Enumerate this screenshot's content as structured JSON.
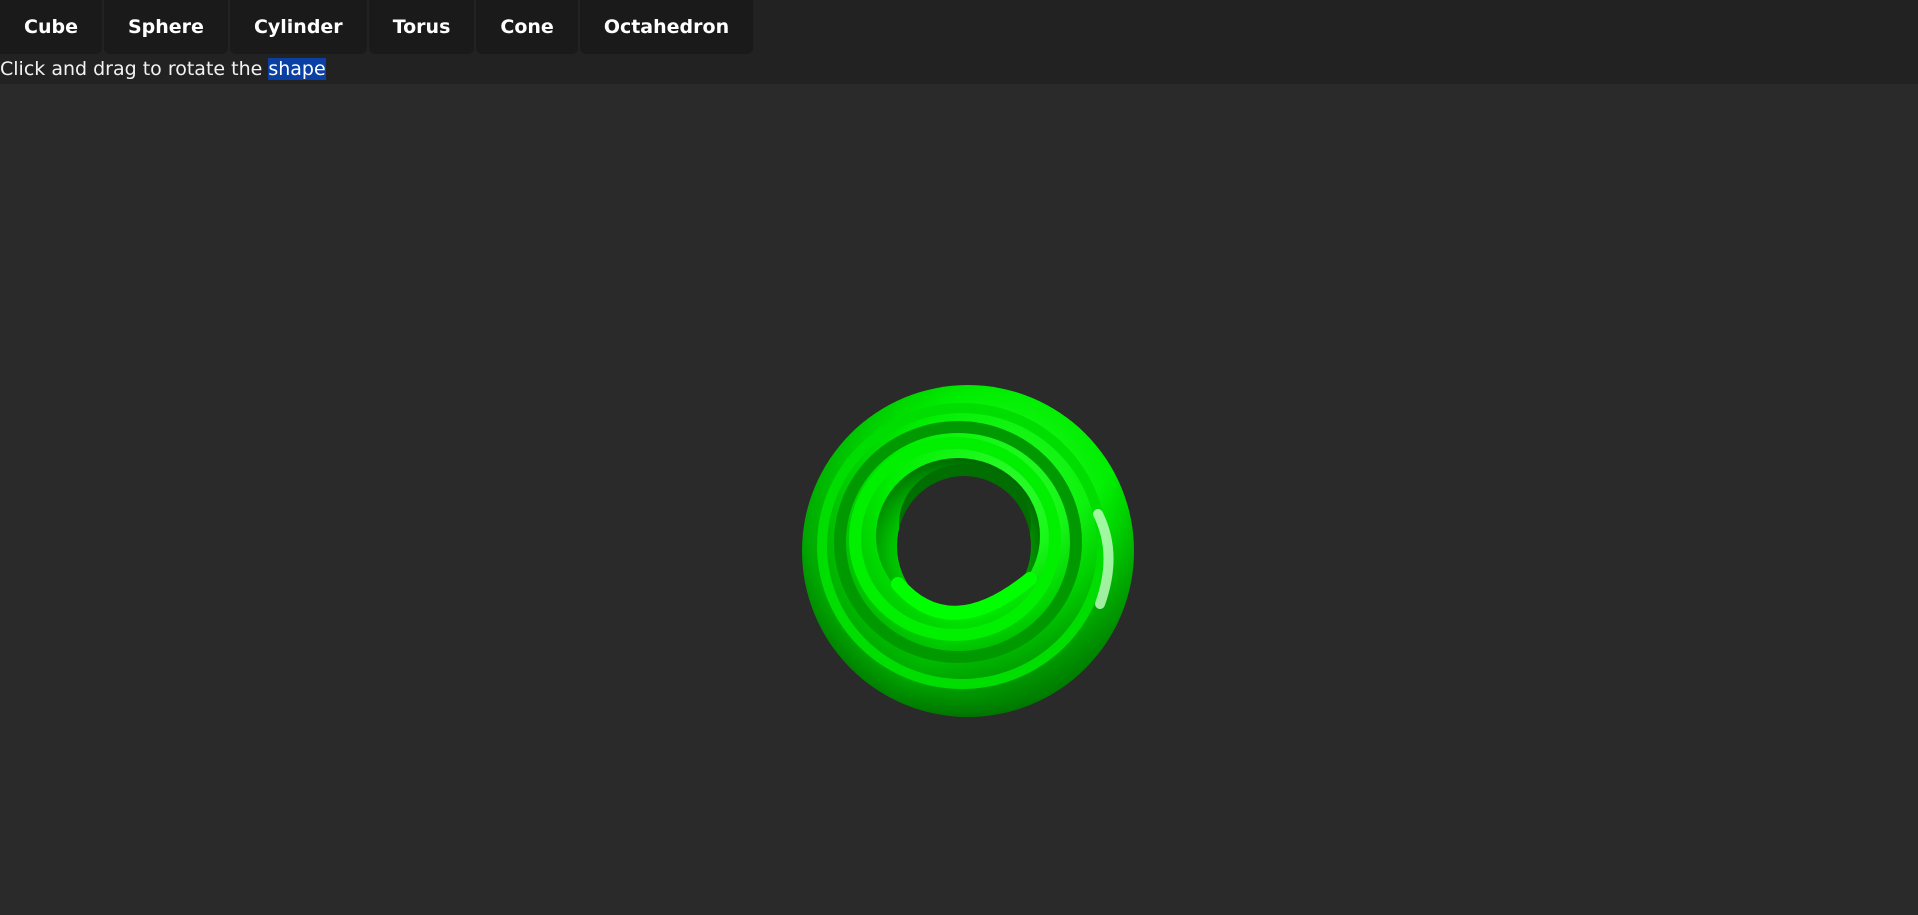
{
  "toolbar": {
    "buttons": [
      {
        "label": "Cube"
      },
      {
        "label": "Sphere"
      },
      {
        "label": "Cylinder"
      },
      {
        "label": "Torus"
      },
      {
        "label": "Cone"
      },
      {
        "label": "Octahedron"
      }
    ]
  },
  "instruction": {
    "text_before": "Click and drag to rotate the ",
    "selected_text": "shape"
  },
  "scene": {
    "current_shape": "torus",
    "shape_color": "#00ff00",
    "background_color": "#2a2a2a"
  }
}
